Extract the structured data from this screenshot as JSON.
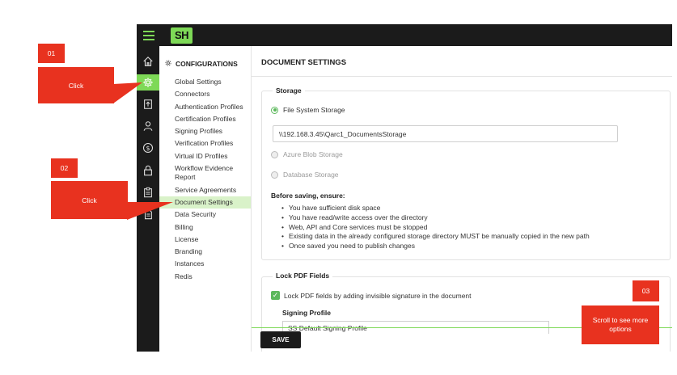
{
  "app": {
    "logo": "SH"
  },
  "nav": {
    "heading": "CONFIGURATIONS",
    "items": [
      "Global Settings",
      "Connectors",
      "Authentication Profiles",
      "Certification Profiles",
      "Signing Profiles",
      "Verification Profiles",
      "Virtual ID Profiles",
      "Workflow Evidence Report",
      "Service Agreements",
      "Document Settings",
      "Data Security",
      "Billing",
      "License",
      "Branding",
      "Instances",
      "Redis"
    ],
    "active_item": "Document Settings"
  },
  "page": {
    "title": "DOCUMENT SETTINGS",
    "storage": {
      "legend": "Storage",
      "options": [
        "File System Storage",
        "Azure Blob Storage",
        "Database Storage"
      ],
      "selected": "File System Storage",
      "path_value": "\\\\192.168.3.45\\Qarc1_DocumentsStorage",
      "ensure_title": "Before saving, ensure:",
      "ensure_items": [
        "You have sufficient disk space",
        "You have read/write access over the directory",
        "Web, API and Core services must be stopped",
        "Existing data in the already configured storage directory MUST be manually copied in the new path",
        "Once saved you need to publish changes"
      ]
    },
    "lock_pdf": {
      "legend": "Lock PDF Fields",
      "checkbox_label": "Lock PDF fields by adding invisible signature in the document",
      "checked": true,
      "signing_profile_label": "Signing Profile",
      "signing_profile_value": "SS Default Signing Profile"
    },
    "save_label": "SAVE"
  },
  "callouts": {
    "step1": {
      "number": "01",
      "text": "Click"
    },
    "step2": {
      "number": "02",
      "text": "Click"
    },
    "step3": {
      "number": "03",
      "text": "Scroll to see more options"
    }
  },
  "colors": {
    "accent": "#7ed957",
    "dark": "#1b1b1b",
    "callout": "#e8321f",
    "active_nav_bg": "#d9f2c9"
  },
  "icons": [
    "hamburger-icon",
    "home-icon",
    "gear-icon",
    "upload-document-icon",
    "user-icon",
    "dollar-icon",
    "lock-icon",
    "clipboard-icon",
    "document-icon"
  ]
}
